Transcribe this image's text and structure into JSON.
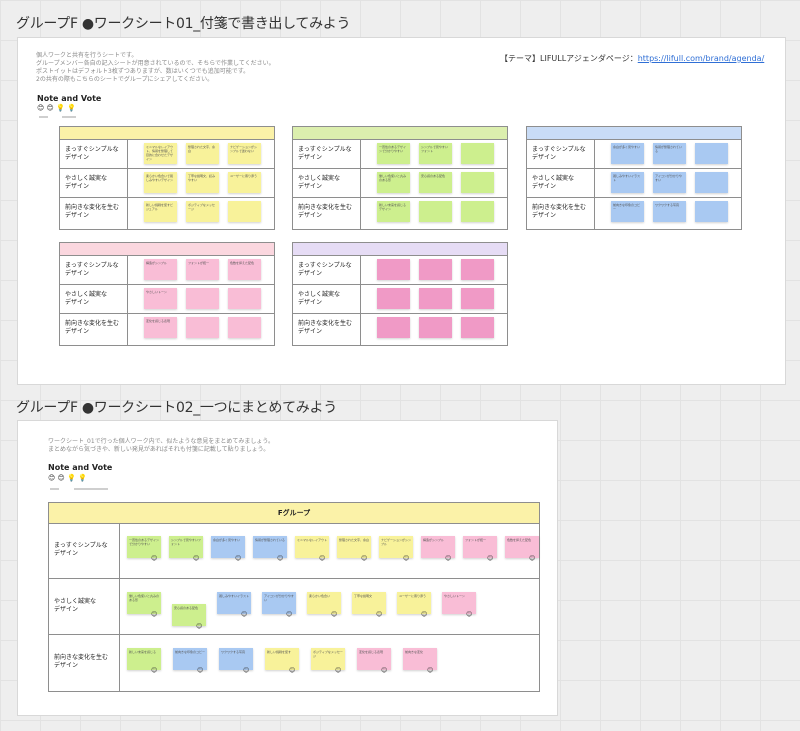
{
  "frame1": {
    "title": "グループF ●ワークシート01_付箋で書き出してみよう",
    "intro": [
      "個人ワークと共有を行うシートです。",
      "グループメンバー各自の記入シートが用意されているので、そちらで作業してください。",
      "ポストイットはデフォルト3枚ずつありますが、数はいくつでも追加可能です。",
      "2の共有の際もこちらのシートでグループにシェアしてください。"
    ],
    "theme_label": "【テーマ】LIFULLアジェンダページ：",
    "theme_link": "https://lifull.com/brand/agenda/",
    "note_vote": {
      "title": "Note and Vote",
      "icons": "😊 😊  💡 💡"
    },
    "rows": [
      "まっすぐシンプルな\nデザイン",
      "やさしく誠実な\nデザイン",
      "前向きな変化を生む\nデザイン"
    ],
    "members": [
      {
        "header_color": "#fbf2a8",
        "note_color": "#f8f29a",
        "notes": [
          [
            "ミニマルなレイアウト、情報を整理して目的に合わせたデザイン",
            "整理された文字、余白",
            "ナビゲーションがシンプルで迷わない"
          ],
          [
            "柔らかい色合いで親しみやすいデザイン",
            "丁寧な説明文、読みやすい",
            "ユーザーに寄り添う"
          ],
          [
            "新しい挑戦を促すビジュアル",
            "ポジティブなメッセージ",
            ""
          ]
        ]
      },
      {
        "header_color": "#dcefae",
        "note_color": "#cdef8e",
        "notes": [
          [
            "一貫性のあるデザインで分かりやすい",
            "シンプルで見やすいフォント",
            ""
          ],
          [
            "優しい色使いと丸みのある形",
            "安心感のある配色",
            ""
          ],
          [
            "新しい未来を感じるデザイン",
            "",
            ""
          ]
        ]
      },
      {
        "header_color": "#c9dcf6",
        "note_color": "#a9c9f2",
        "notes": [
          [
            "余白が多く見やすい",
            "情報が整理されている",
            ""
          ],
          [
            "親しみやすいイラスト",
            "アイコンが分かりやすい",
            ""
          ],
          [
            "前向きな印象のコピー",
            "ワクワクする写真",
            ""
          ]
        ]
      },
      {
        "header_color": "#fbd7df",
        "note_color": "#f9bdd6",
        "notes": [
          [
            "構造がシンプル",
            "フォントが統一",
            "色数を抑えた配色"
          ],
          [
            "やさしいトーン",
            "",
            ""
          ],
          [
            "変化を感じる表現",
            "",
            ""
          ]
        ]
      },
      {
        "header_color": "#e6dcf5",
        "note_color": "#f09ac6",
        "notes": [
          [
            "",
            "",
            ""
          ],
          [
            "",
            "",
            ""
          ],
          [
            "",
            "",
            ""
          ]
        ]
      }
    ]
  },
  "frame2": {
    "title": "グループF ●ワークシート02_一つにまとめてみよう",
    "intro": [
      "ワークシート_01で行った個人ワーク内で、似たような意見をまとめてみましょう。",
      "まとめながら気づきや、新しい発見があればそれも付箋に記載して貼りましょう。"
    ],
    "note_vote": {
      "title": "Note and Vote",
      "icons": "😊 😊  💡 💡"
    },
    "table_header": "Fグループ",
    "header_color": "#fbf2a8",
    "rows": [
      "まっすぐシンプルな\nデザイン",
      "やさしく誠実な\nデザイン",
      "前向きな変化を生む\nデザイン"
    ],
    "row_notes": [
      [
        {
          "color": "#cdef8e",
          "text": "一貫性のあるデザインで分かりやすい"
        },
        {
          "color": "#cdef8e",
          "text": "シンプルで見やすいフォント"
        },
        {
          "color": "#a9c9f2",
          "text": "余白が多く見やすい"
        },
        {
          "color": "#a9c9f2",
          "text": "情報が整理されている"
        },
        {
          "color": "#f8f29a",
          "text": "ミニマルなレイアウト"
        },
        {
          "color": "#f8f29a",
          "text": "整理された文字、余白"
        },
        {
          "color": "#f8f29a",
          "text": "ナビゲーションがシンプル"
        },
        {
          "color": "#f9bdd6",
          "text": "構造がシンプル"
        },
        {
          "color": "#f9bdd6",
          "text": "フォントが統一"
        },
        {
          "color": "#f9bdd6",
          "text": "色数を抑えた配色"
        }
      ],
      [
        {
          "color": "#cdef8e",
          "text": "優しい色使いと丸みのある形"
        },
        {
          "color": "#cdef8e",
          "text": "安心感のある配色"
        },
        {
          "color": "#a9c9f2",
          "text": "親しみやすいイラスト"
        },
        {
          "color": "#a9c9f2",
          "text": "アイコンが分かりやすい"
        },
        {
          "color": "#f8f29a",
          "text": "柔らかい色合い"
        },
        {
          "color": "#f8f29a",
          "text": "丁寧な説明文"
        },
        {
          "color": "#f8f29a",
          "text": "ユーザーに寄り添う"
        },
        {
          "color": "#f9bdd6",
          "text": "やさしいトーン"
        }
      ],
      [
        {
          "color": "#cdef8e",
          "text": "新しい未来を感じる"
        },
        {
          "color": "#a9c9f2",
          "text": "前向きな印象のコピー"
        },
        {
          "color": "#a9c9f2",
          "text": "ワクワクする写真"
        },
        {
          "color": "#f8f29a",
          "text": "新しい挑戦を促す"
        },
        {
          "color": "#f8f29a",
          "text": "ポジティブなメッセージ"
        },
        {
          "color": "#f9bdd6",
          "text": "変化を感じる表現"
        },
        {
          "color": "#f9bdd6",
          "text": "前向きな変化"
        }
      ]
    ],
    "vote_icon": "😊"
  }
}
